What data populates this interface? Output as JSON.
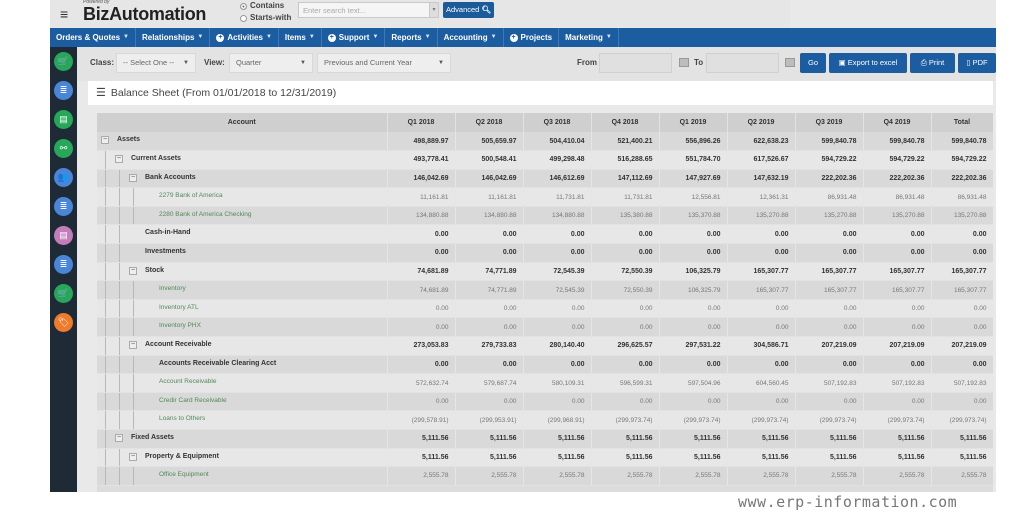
{
  "header": {
    "powered_by": "Powered by",
    "brand": "BizAutomation",
    "search_mode": {
      "options": [
        "Contains",
        "Starts-with"
      ],
      "selected": "Contains"
    },
    "search_placeholder": "Enter search text...",
    "advanced_label": "Advanced"
  },
  "nav": {
    "items": [
      {
        "label": "Orders & Quotes",
        "caret": true,
        "icon": false
      },
      {
        "label": "Relationships",
        "caret": true,
        "icon": false
      },
      {
        "label": "Activities",
        "caret": true,
        "icon": true
      },
      {
        "label": "Items",
        "caret": true,
        "icon": false
      },
      {
        "label": "Support",
        "caret": true,
        "icon": true
      },
      {
        "label": "Reports",
        "caret": true,
        "icon": false
      },
      {
        "label": "Accounting",
        "caret": true,
        "icon": false
      },
      {
        "label": "Projects",
        "caret": false,
        "icon": true
      },
      {
        "label": "Marketing",
        "caret": true,
        "icon": false
      }
    ]
  },
  "sidebar": {
    "icons": [
      {
        "name": "cart-icon",
        "color": "#27a75a",
        "glyph": "🛒"
      },
      {
        "name": "document-stack-icon",
        "color": "#4a86d8",
        "glyph": "≣"
      },
      {
        "name": "document-icon",
        "color": "#27a75a",
        "glyph": "▤"
      },
      {
        "name": "handshake-icon",
        "color": "#27a75a",
        "glyph": "⚯"
      },
      {
        "name": "contacts-icon",
        "color": "#4a86d8",
        "glyph": "👥"
      },
      {
        "name": "document-stack-icon",
        "color": "#4a86d8",
        "glyph": "≣"
      },
      {
        "name": "notes-icon",
        "color": "#c47dbb",
        "glyph": "▤"
      },
      {
        "name": "document-stack-icon",
        "color": "#4a86d8",
        "glyph": "≣"
      },
      {
        "name": "cart-icon",
        "color": "#27a75a",
        "glyph": "🛒"
      },
      {
        "name": "tag-icon",
        "color": "#ef7b2d",
        "glyph": "🏷"
      }
    ]
  },
  "filters": {
    "class_label": "Class:",
    "class_value": "-- Select One --",
    "view_label": "View:",
    "view_value": "Quarter",
    "period_value": "Previous and Current Year",
    "from_label": "From",
    "from_value": "",
    "to_label": "To",
    "to_value": "",
    "go_label": "Go",
    "export_label": "Export to excel",
    "print_label": "Print",
    "pdf_label": "PDF"
  },
  "report": {
    "title": "Balance Sheet (From 01/01/2018 to 12/31/2019)",
    "columns": [
      "Account",
      "Q1 2018",
      "Q2 2018",
      "Q3 2018",
      "Q4 2018",
      "Q1 2019",
      "Q2 2019",
      "Q3 2019",
      "Q4 2019",
      "Total"
    ],
    "rows": [
      {
        "level": 0,
        "type": "bold",
        "toggle": true,
        "account": "Assets",
        "values": [
          "498,889.97",
          "505,659.97",
          "504,410.04",
          "521,400.21",
          "556,896.26",
          "622,638.23",
          "599,840.78",
          "599,840.78",
          "599,840.78"
        ]
      },
      {
        "level": 1,
        "type": "bold",
        "toggle": true,
        "account": "Current Assets",
        "values": [
          "493,778.41",
          "500,548.41",
          "499,298.48",
          "516,288.65",
          "551,784.70",
          "617,526.67",
          "594,729.22",
          "594,729.22",
          "594,729.22"
        ]
      },
      {
        "level": 2,
        "type": "bold",
        "toggle": true,
        "account": "Bank Accounts",
        "values": [
          "146,042.69",
          "146,042.69",
          "146,612.69",
          "147,112.69",
          "147,927.69",
          "147,632.19",
          "222,202.36",
          "222,202.36",
          "222,202.36"
        ]
      },
      {
        "level": 3,
        "type": "leaf",
        "toggle": false,
        "account": "2279 Bank of America",
        "values": [
          "11,161.81",
          "11,161.81",
          "11,731.81",
          "11,731.81",
          "12,556.81",
          "12,361.31",
          "86,931.48",
          "86,931.48",
          "86,931.48"
        ]
      },
      {
        "level": 3,
        "type": "leaf",
        "toggle": false,
        "account": "2280 Bank of America Checking",
        "values": [
          "134,880.88",
          "134,880.88",
          "134,880.88",
          "135,380.88",
          "135,370.88",
          "135,270.88",
          "135,270.88",
          "135,270.88",
          "135,270.88"
        ]
      },
      {
        "level": 2,
        "type": "bold",
        "toggle": false,
        "account": "Cash-in-Hand",
        "values": [
          "0.00",
          "0.00",
          "0.00",
          "0.00",
          "0.00",
          "0.00",
          "0.00",
          "0.00",
          "0.00"
        ]
      },
      {
        "level": 2,
        "type": "bold",
        "toggle": false,
        "account": "Investments",
        "values": [
          "0.00",
          "0.00",
          "0.00",
          "0.00",
          "0.00",
          "0.00",
          "0.00",
          "0.00",
          "0.00"
        ]
      },
      {
        "level": 2,
        "type": "bold",
        "toggle": true,
        "account": "Stock",
        "values": [
          "74,681.89",
          "74,771.89",
          "72,545.39",
          "72,550.39",
          "106,325.79",
          "165,307.77",
          "165,307.77",
          "165,307.77",
          "165,307.77"
        ]
      },
      {
        "level": 3,
        "type": "leaf",
        "toggle": false,
        "account": "Inventory",
        "values": [
          "74,681.89",
          "74,771.89",
          "72,545.39",
          "72,550.39",
          "106,325.79",
          "165,307.77",
          "165,307.77",
          "165,307.77",
          "165,307.77"
        ]
      },
      {
        "level": 3,
        "type": "leaf",
        "toggle": false,
        "account": "Inventory ATL",
        "values": [
          "0.00",
          "0.00",
          "0.00",
          "0.00",
          "0.00",
          "0.00",
          "0.00",
          "0.00",
          "0.00"
        ]
      },
      {
        "level": 3,
        "type": "leaf",
        "toggle": false,
        "account": "Inventory PHX",
        "values": [
          "0.00",
          "0.00",
          "0.00",
          "0.00",
          "0.00",
          "0.00",
          "0.00",
          "0.00",
          "0.00"
        ]
      },
      {
        "level": 2,
        "type": "bold",
        "toggle": true,
        "account": "Account Receivable",
        "values": [
          "273,053.83",
          "279,733.83",
          "280,140.40",
          "296,625.57",
          "297,531.22",
          "304,586.71",
          "207,219.09",
          "207,219.09",
          "207,219.09"
        ]
      },
      {
        "level": 3,
        "type": "bold",
        "toggle": false,
        "account": "Accounts Receivable Clearing Acct",
        "values": [
          "0.00",
          "0.00",
          "0.00",
          "0.00",
          "0.00",
          "0.00",
          "0.00",
          "0.00",
          "0.00"
        ]
      },
      {
        "level": 3,
        "type": "leaf",
        "toggle": false,
        "account": "Account Receivable",
        "values": [
          "572,632.74",
          "579,687.74",
          "580,109.31",
          "596,599.31",
          "597,504.96",
          "604,560.45",
          "507,192.83",
          "507,192.83",
          "507,192.83"
        ]
      },
      {
        "level": 3,
        "type": "leaf",
        "toggle": false,
        "account": "Credir Card Receivable",
        "values": [
          "0.00",
          "0.00",
          "0.00",
          "0.00",
          "0.00",
          "0.00",
          "0.00",
          "0.00",
          "0.00"
        ]
      },
      {
        "level": 3,
        "type": "leaf",
        "toggle": false,
        "account": "Loans to Others",
        "values": [
          "(299,578.91)",
          "(299,953.91)",
          "(299,968.91)",
          "(299,973.74)",
          "(299,973.74)",
          "(299,973.74)",
          "(299,973.74)",
          "(299,973.74)",
          "(299,973.74)"
        ]
      },
      {
        "level": 1,
        "type": "bold",
        "toggle": true,
        "account": "Fixed Assets",
        "values": [
          "5,111.56",
          "5,111.56",
          "5,111.56",
          "5,111.56",
          "5,111.56",
          "5,111.56",
          "5,111.56",
          "5,111.56",
          "5,111.56"
        ]
      },
      {
        "level": 2,
        "type": "bold",
        "toggle": true,
        "account": "Property & Equipment",
        "values": [
          "5,111.56",
          "5,111.56",
          "5,111.56",
          "5,111.56",
          "5,111.56",
          "5,111.56",
          "5,111.56",
          "5,111.56",
          "5,111.56"
        ]
      },
      {
        "level": 3,
        "type": "leaf",
        "toggle": false,
        "account": "Office Equipment",
        "values": [
          "2,555.78",
          "2,555.78",
          "2,555.78",
          "2,555.78",
          "2,555.78",
          "2,555.78",
          "2,555.78",
          "2,555.78",
          "2,555.78"
        ]
      }
    ]
  },
  "watermark": "www.erp-information.com"
}
